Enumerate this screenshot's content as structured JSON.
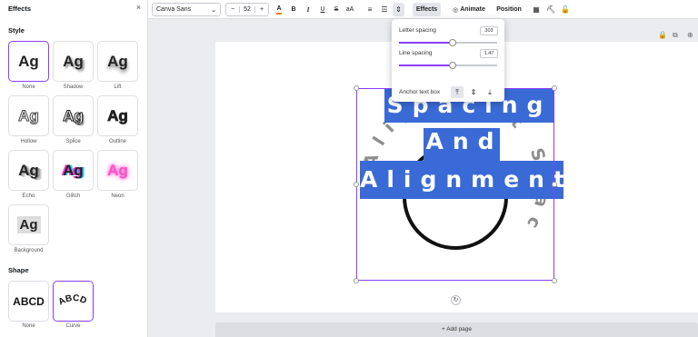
{
  "panel": {
    "title": "Effects",
    "style_title": "Style",
    "shape_title": "Shape",
    "styles": [
      {
        "label": "None",
        "sample": "Ag"
      },
      {
        "label": "Shadow",
        "sample": "Ag"
      },
      {
        "label": "Lift",
        "sample": "Ag"
      },
      {
        "label": "Hollow",
        "sample": "Ag"
      },
      {
        "label": "Splice",
        "sample": "Ag"
      },
      {
        "label": "Outline",
        "sample": "Ag"
      },
      {
        "label": "Echo",
        "sample": "Ag"
      },
      {
        "label": "Glitch",
        "sample": "Ag"
      },
      {
        "label": "Neon",
        "sample": "Ag"
      },
      {
        "label": "Background",
        "sample": "Ag"
      }
    ],
    "shapes": [
      {
        "label": "None",
        "sample": "ABCD"
      },
      {
        "label": "Curve",
        "sample": "ABCD"
      }
    ]
  },
  "toolbar": {
    "font": "Canva Sans",
    "size_minus": "−",
    "size": "52",
    "size_plus": "+",
    "bold": "B",
    "italic": "I",
    "underline": "U",
    "strike": "S",
    "case": "aA",
    "effects_label": "Effects",
    "animate_label": "Animate",
    "position_label": "Position"
  },
  "popover": {
    "letter_spacing_label": "Letter spacing",
    "letter_spacing_value": "303",
    "letter_spacing_fraction": 0.55,
    "line_spacing_label": "Line spacing",
    "line_spacing_value": "1.47",
    "line_spacing_fraction": 0.55,
    "anchor_label": "Anchor text box"
  },
  "design": {
    "line1": "Spacing",
    "line2": "And",
    "line3": "Alignment",
    "curved_text": "Alignment Spac",
    "highlight_color": "#3a6ad6"
  },
  "add_page_label": "+ Add page",
  "colors": {
    "accent": "#8b3dff",
    "highlight": "#3a6ad6"
  }
}
